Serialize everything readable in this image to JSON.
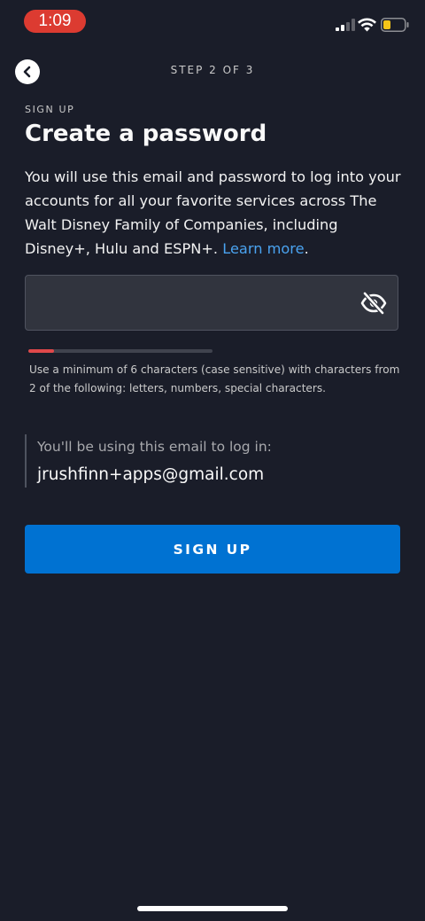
{
  "status_bar": {
    "time": "1:09",
    "time_pill_color": "#dc3b31",
    "battery_color": "#f5c518",
    "icons": [
      "signal-icon",
      "wifi-icon",
      "battery-icon"
    ]
  },
  "header": {
    "back_icon": "chevron-left-icon",
    "step": "STEP 2 OF 3"
  },
  "form": {
    "eyebrow": "SIGN UP",
    "title": "Create a password",
    "description": "You will use this email and password to log into your accounts for all your favorite services across The Walt Disney Family of Companies, including Disney+, Hulu and ESPN+.",
    "learn_more": "Learn more",
    "description_end": ".",
    "password": {
      "value": "",
      "placeholder": "",
      "toggle_icon": "eye-off-icon"
    },
    "strength": {
      "level": 0.14,
      "fill_color": "#e0484a"
    },
    "hint": "Use a minimum of 6 characters (case sensitive) with characters from 2 of the following: letters, numbers, special characters.",
    "email_caption": "You'll be using this email to log in:",
    "email": "jrushfinn+apps@gmail.com",
    "submit_label": "SIGN UP",
    "accent_color": "#0072d2",
    "link_color": "#4aa3f0"
  }
}
